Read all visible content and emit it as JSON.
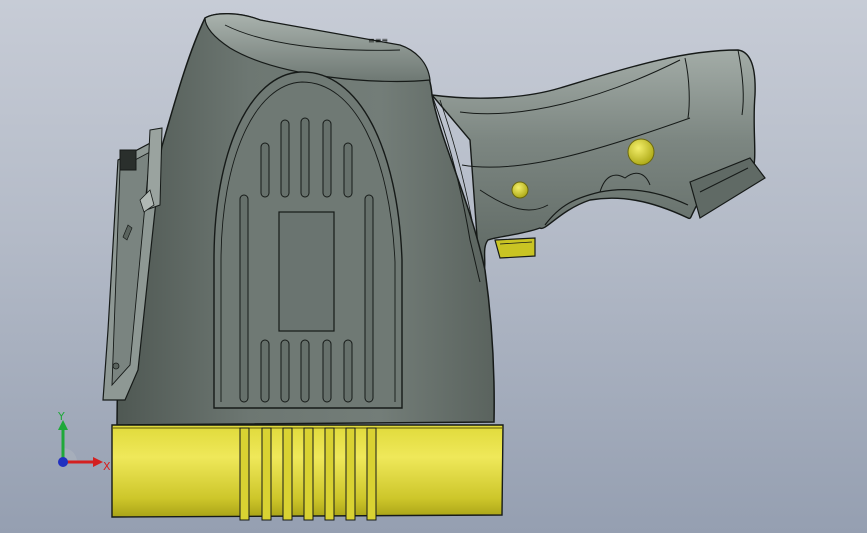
{
  "viewport": {
    "background_top": "#c7ccd6",
    "background_bottom": "#959fb1"
  },
  "model": {
    "body_color": "#66706b",
    "body_highlight": "#8e9893",
    "base_color": "#c9c423",
    "base_highlight": "#efe85a",
    "button_color": "#c6c21c",
    "edge_color": "#161a18",
    "embossed_text": "≡≡≡"
  },
  "triad": {
    "x_label": "X",
    "y_label": "Y",
    "x_color": "#d42020",
    "y_color": "#1fa83a",
    "z_color": "#2030c0"
  }
}
